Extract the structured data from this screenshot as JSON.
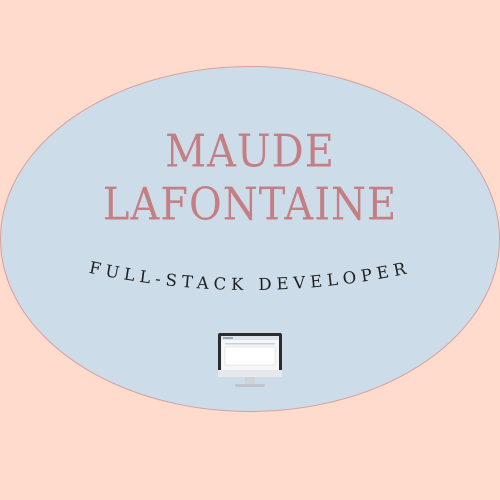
{
  "name": {
    "first": "MAUDE",
    "last": "LAFONTAINE"
  },
  "subtitle": "FULL-STACK DEVELOPER",
  "icon": "desktop-computer-icon",
  "colors": {
    "background": "#fedbcd",
    "oval_fill": "#ccdde9",
    "oval_border": "#d79fa1",
    "name": "#c47f85",
    "subtitle": "#1f1f1f"
  }
}
